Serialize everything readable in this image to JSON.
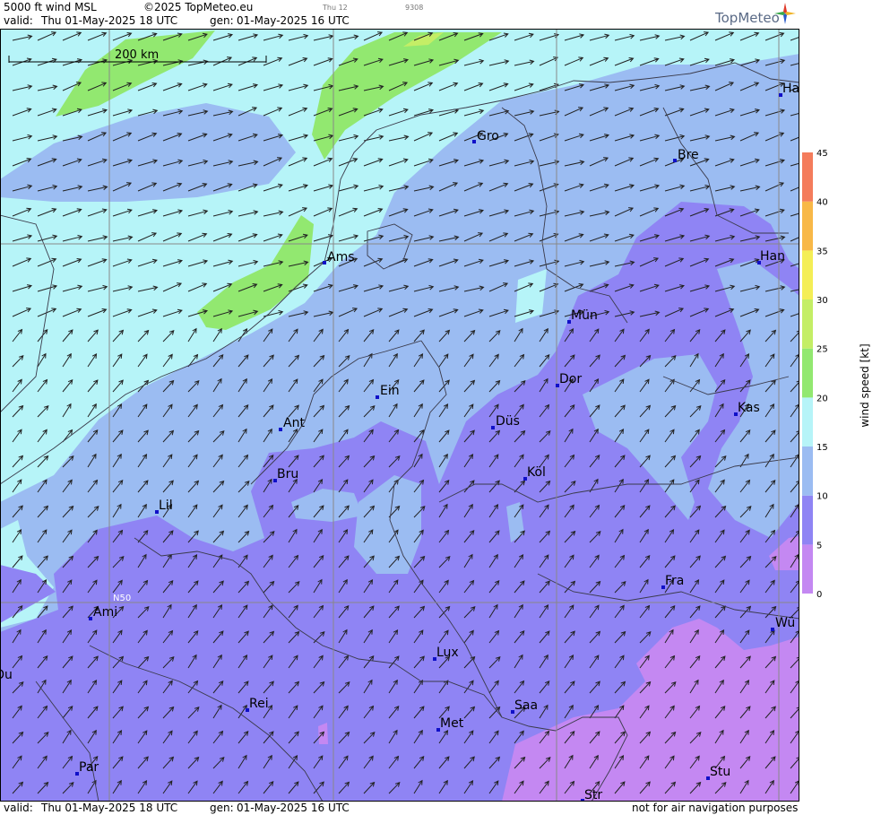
{
  "header": {
    "product": "5000 ft wind MSL",
    "copyright": "©2025 TopMeteo.eu",
    "day_tag": "Thu 12",
    "code": "9308",
    "valid_label": "valid:",
    "valid_time": "Thu  01-May-2025  18 UTC",
    "gen_label": "gen:",
    "gen_time": "01-May-2025 16 UTC",
    "logo_text": "TopMeteo"
  },
  "footer": {
    "valid_label": "valid:",
    "valid_time": "Thu  01-May-2025  18 UTC",
    "gen_label": "gen:",
    "gen_time": "01-May-2025 16 UTC",
    "disclaimer": "not for air navigation purposes"
  },
  "map": {
    "scale_label": "200 km",
    "lat_label": "N50",
    "wind_direction": "SW",
    "cities": [
      {
        "name": "Gro"
      },
      {
        "name": "Bre"
      },
      {
        "name": "Ha"
      },
      {
        "name": "Ams"
      },
      {
        "name": "Han"
      },
      {
        "name": "Mün"
      },
      {
        "name": "Ein"
      },
      {
        "name": "Dor"
      },
      {
        "name": "Kas"
      },
      {
        "name": "Ant"
      },
      {
        "name": "Düs"
      },
      {
        "name": "Bru"
      },
      {
        "name": "Köl"
      },
      {
        "name": "Lil"
      },
      {
        "name": "Fra"
      },
      {
        "name": "Ami"
      },
      {
        "name": "Wü"
      },
      {
        "name": "Lux"
      },
      {
        "name": "Ou"
      },
      {
        "name": "Rei"
      },
      {
        "name": "Saa"
      },
      {
        "name": "Met"
      },
      {
        "name": "Par"
      },
      {
        "name": "Stu"
      },
      {
        "name": "Str"
      }
    ]
  },
  "legend": {
    "title": "wind  speed  [kt]",
    "ticks": [
      "0",
      "5",
      "10",
      "15",
      "20",
      "25",
      "30",
      "35",
      "40",
      "45"
    ],
    "colors": [
      "#c488f2",
      "#8f84f4",
      "#9bbcf2",
      "#b6f4f8",
      "#92e870",
      "#c4ee66",
      "#f4ee56",
      "#f8b848",
      "#f47c5c"
    ]
  },
  "colors": {
    "band_0_5": "#c488f2",
    "band_5_10": "#8f84f4",
    "band_10_15": "#9bbcf2",
    "band_15_20": "#b6f4f8",
    "band_20_25": "#92e870",
    "band_25_30": "#c4ee66",
    "city_marker": "#1010c8"
  }
}
